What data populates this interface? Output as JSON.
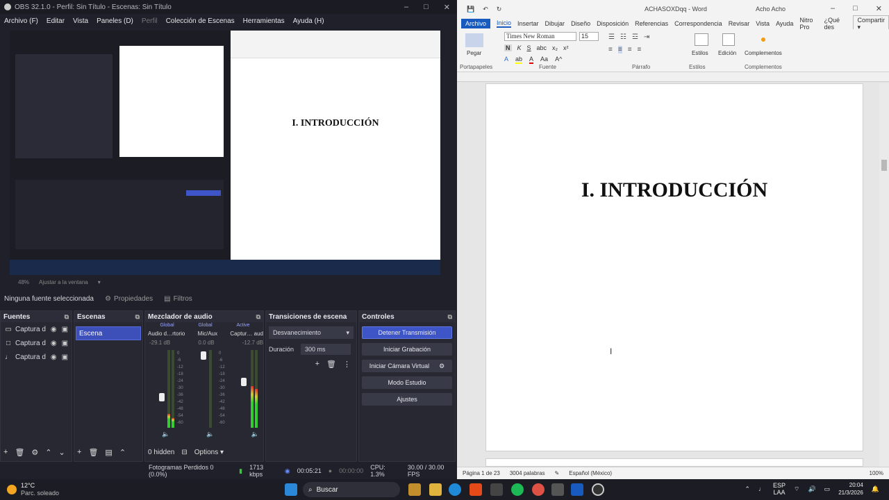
{
  "obs": {
    "title": "OBS 32.1.0 - Perfil: Sin Título - Escenas: Sin Título",
    "menu": [
      "Archivo (F)",
      "Editar",
      "Vista",
      "Paneles (D)",
      "Perfil",
      "Colección de Escenas",
      "Herramientas",
      "Ayuda (H)"
    ],
    "preview_heading": "I. INTRODUCCIÓN",
    "zoom": "48%",
    "zoom_mode": "Ajustar a la ventana",
    "no_source": "Ninguna fuente seleccionada",
    "properties": "Propiedades",
    "filters": "Filtros",
    "sources_title": "Fuentes",
    "sources": [
      {
        "label": "Captura d",
        "icon": "monitor-icon"
      },
      {
        "label": "Captura d",
        "icon": "window-icon"
      },
      {
        "label": "Captura d",
        "icon": "mic-icon"
      }
    ],
    "scenes_title": "Escenas",
    "scene": "Escena",
    "mixer_title": "Mezclador de audio",
    "mixer_channels": [
      {
        "badge": "Global",
        "name": "Audio d…rtorio",
        "db": "-29.1 dB"
      },
      {
        "badge": "Global",
        "name": "Mic/Aux",
        "db": "0.0 dB"
      },
      {
        "badge": "Active",
        "name": "Captur… aud",
        "db": "-12.7 dB"
      }
    ],
    "mixer_scale": [
      "0",
      "-6",
      "-12",
      "-18",
      "-24",
      "-30",
      "-36",
      "-42",
      "-48",
      "-54",
      "-60"
    ],
    "hidden": "0 hidden",
    "options": "Options",
    "transitions_title": "Transiciones de escena",
    "transition": "Desvanecimiento",
    "duration_label": "Duración",
    "duration": "300 ms",
    "controls_title": "Controles",
    "controls": [
      "Detener Transmisión",
      "Iniciar Grabación",
      "Iniciar Cámara Virtual",
      "Modo Estudio",
      "Ajustes"
    ],
    "status": {
      "dropped": "Fotogramas Perdidos 0 (0.0%)",
      "bitrate": "1713 kbps",
      "stream_time": "00:05:21",
      "rec_time": "00:00:00",
      "cpu": "CPU: 1.3%",
      "fps": "30.00 / 30.00 FPS"
    }
  },
  "word": {
    "title": "ACHASOXDqq - Word",
    "user": "Acho Acho",
    "tabs": [
      "Archivo",
      "Inicio",
      "Insertar",
      "Dibujar",
      "Diseño",
      "Disposición",
      "Referencias",
      "Correspondencia",
      "Revisar",
      "Vista",
      "Ayuda",
      "Nitro Pro"
    ],
    "tell_me": "¿Qué des",
    "share": "Compartir",
    "font": "Times New Roman",
    "font_size": "15",
    "groups": {
      "paste": "Pegar",
      "clipboard": "Portapapeles",
      "font": "Fuente",
      "paragraph": "Párrafo",
      "styles_btn": "Estilos",
      "styles": "Estilos",
      "edit": "Edición",
      "addins_btn": "Complementos",
      "addins": "Complementos"
    },
    "heading": "I. INTRODUCCIÓN",
    "status": {
      "page": "Página 1 de 23",
      "words": "3004 palabras",
      "lang": "Español (México)",
      "zoom": "100%"
    }
  },
  "taskbar": {
    "temp": "12°C",
    "weather": "Parc. soleado",
    "search": "Buscar",
    "lang": "ESP",
    "lang2": "LAA",
    "time": "20:04",
    "date": "21/3/2026"
  }
}
